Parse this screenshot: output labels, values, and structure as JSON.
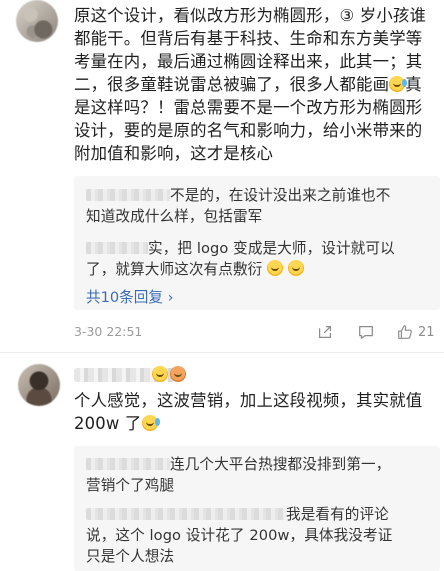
{
  "comment1": {
    "lines": [
      "原这个设计，看似改方形为椭圆形，③ 岁小孩谁",
      "都能干。但背后有基于科技、生命和东方美学等",
      "考量在内，最后通过椭圆诠释出来，此其一；其",
      "二，很多童鞋说雷总被骗了，很多人都能画",
      "是这样吗？！雷总需要不是一个改方形为椭圆形",
      "设计，要的是原的名气和影响力，给小米带来的",
      "附加值和影响，这才是核心"
    ],
    "line4_suffix": "真",
    "replies": [
      {
        "line1": "不是的，在设计没出来之前谁也不",
        "line2": "知道改成什么样，包括雷军"
      },
      {
        "line1": "实，把 logo 变成是大师，设计就可以",
        "line2": "了，就算大师这次有点敷衍"
      }
    ],
    "see_more": "共10条回复",
    "see_more_arrow": "›",
    "date": "3-30 22:51",
    "like_count": "21"
  },
  "comment2": {
    "lines": [
      "个人感觉，这波营销，加上这段视频，其实就值",
      "200w 了"
    ],
    "replies": [
      {
        "line1": "连几个大平台热搜都没排到第一，",
        "line2": "营销个了鸡腿"
      },
      {
        "line1": "我是看有的评论",
        "line2": "说，这个 logo 设计花了 200w，具体我没考证",
        "line3": "只是个人想法"
      }
    ]
  },
  "icons": {
    "share": "share-icon",
    "comment": "comment-icon",
    "like": "like-icon"
  }
}
